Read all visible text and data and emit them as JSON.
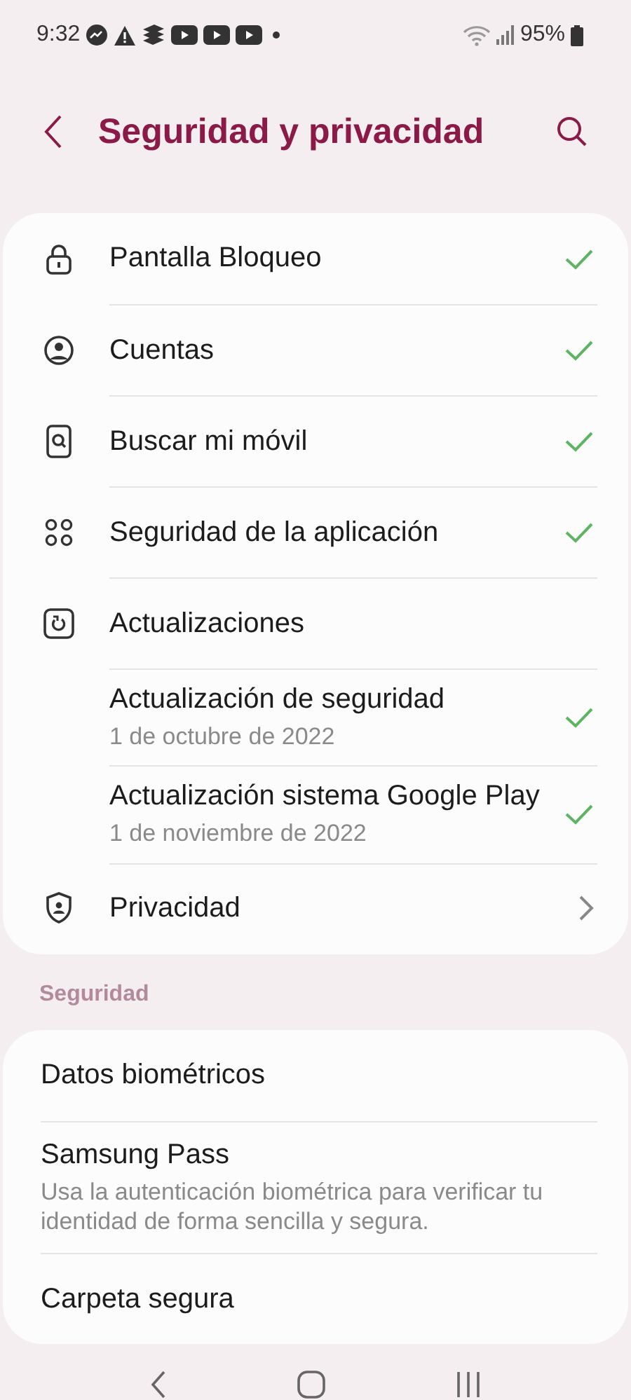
{
  "status_bar": {
    "time": "9:32",
    "battery": "95%"
  },
  "header": {
    "title": "Seguridad y privacidad"
  },
  "main_card": {
    "items": [
      {
        "label": "Pantalla Bloqueo",
        "kind": "check"
      },
      {
        "label": "Cuentas",
        "kind": "check"
      },
      {
        "label": "Buscar mi móvil",
        "kind": "check"
      },
      {
        "label": "Seguridad de la aplicación",
        "kind": "check"
      },
      {
        "label": "Actualizaciones",
        "kind": "plain",
        "children": [
          {
            "label": "Actualización de seguridad",
            "subtitle": "1 de octubre de 2022",
            "kind": "check"
          },
          {
            "label": "Actualización sistema Google Play",
            "subtitle": "1 de noviembre de 2022",
            "kind": "check"
          }
        ]
      },
      {
        "label": "Privacidad",
        "kind": "chevron"
      }
    ]
  },
  "section": {
    "title": "Seguridad",
    "items": [
      {
        "label": "Datos biométricos"
      },
      {
        "label": "Samsung Pass",
        "subtitle": "Usa la autenticación biométrica para verificar tu identidad de forma sencilla y segura."
      },
      {
        "label": "Carpeta segura"
      }
    ]
  }
}
